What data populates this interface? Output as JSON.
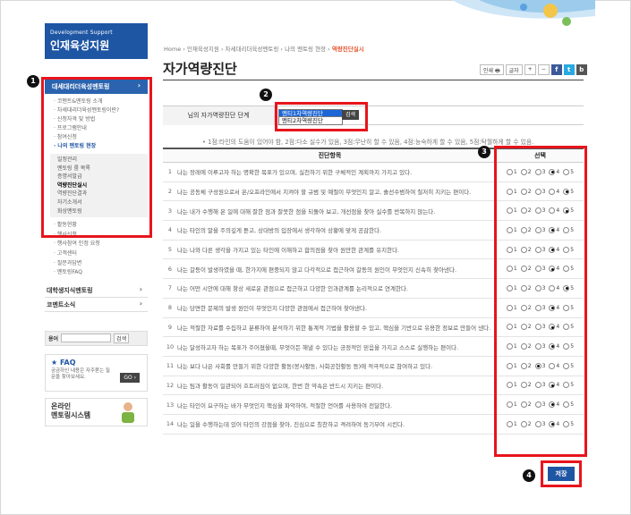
{
  "sidebar": {
    "banner_small": "Development Support",
    "banner_big": "인재육성지원",
    "category": "대세대리더육성멘토링",
    "sub_items_top": [
      "코멘트&멘토링 소개",
      "차세대리더육성멘토링이란?",
      "신청자격 및 방법",
      "프로그램안내",
      "참여신청",
      "나의 멘토링 현장"
    ],
    "active_sub": "나의 멘토링 현장",
    "box_items": [
      "일정관리",
      "멘토링 룸 목록",
      "증명서발급",
      "역량진단실시",
      "역량진단결과",
      "자기소개서",
      "화상멘토링"
    ],
    "active_box": "역량진단실시",
    "sub_items_bottom": [
      "활동현황",
      "행사신청",
      "행사참여 인정 요청",
      "고객센터",
      "질문과답변",
      "멘토링FAQ"
    ],
    "menu": [
      "대학생지식멘토링",
      "코멘트소식"
    ],
    "search_label": "용어",
    "search_button": "검색",
    "faq_title": "FAQ",
    "faq_desc": "궁금하신 내용은 자주묻는 질문을 찾아보세요.",
    "faq_go": "GO",
    "online_line1": "온라인",
    "online_line2": "멘토링시스템"
  },
  "header": {
    "breadcrumb_path": "Home › 인재육성지원 › 차세대리더육성멘토링 › 나의 멘토링 현장 ›",
    "breadcrumb_current": "역량진단실시",
    "title": "자가역량진단",
    "print_label": "인쇄",
    "font_label": "글자",
    "plus": "+",
    "minus": "−",
    "fb": "f",
    "tw": "t",
    "blog": "b"
  },
  "step": {
    "label": "님의 자가역량진단 단계",
    "options": [
      "멘티1차역량진단",
      "멘티2차역량진단"
    ],
    "selected": "멘티1차역량진단",
    "button": "검색"
  },
  "legend": "• 1점:타인의 도움이 있어야 함, 2점:다소 실수가 있음, 3점:무난히 할 수 있음, 4점:능숙하게 할 수 있음, 5점:탁월하게 할 수 있음.",
  "table": {
    "col_item": "진단항목",
    "col_choice": "선택",
    "scale": [
      "1",
      "2",
      "3",
      "4",
      "5"
    ],
    "rows": [
      {
        "num": "1",
        "text": "나는 장래에 이루고자 하는 명확한 목표가 있으며, 실천하기 위한 구체적인 계획까지 가지고 있다.",
        "selected": 4
      },
      {
        "num": "2",
        "text": "나는 공동체 구성원으로서 온/오프라인에서 지켜야 할 규범 및 예절이 무엇인지 알고, 솔선수범하여 철저히 지키는 편이다.",
        "selected": 5
      },
      {
        "num": "3",
        "text": "나는 내가 수행해 온 일에 대해 잘한 점과 잘못한 점을 되돌아 보고, 개선점을 찾아 실수를 반복하지 않는다.",
        "selected": 5
      },
      {
        "num": "4",
        "text": "나는 타인의 말을 주의깊게 듣고, 상대방의 입장에서 생각하여 상황에 맞게 공감한다.",
        "selected": 4
      },
      {
        "num": "5",
        "text": "나는 나와 다른 생각을 가지고 있는 타인에 이해하고 합의점을 찾아 원만한 관계를 유지한다.",
        "selected": 4
      },
      {
        "num": "6",
        "text": "나는 갈등이 발생하였을 때, 한가지에 편중되지 않고 다각적으로 접근하여 갈등의 원인이 무엇인지 신속히 찾아낸다.",
        "selected": 4
      },
      {
        "num": "7",
        "text": "나는 어떤 시안에 대해 항상 새로운 관점으로 접근하고 다양한 인과관계를 논리적으로 연계한다.",
        "selected": 5
      },
      {
        "num": "8",
        "text": "나는 당면한 문제의 발생 원인이 무엇인지 다양한 관점에서 접근하여 찾아낸다.",
        "selected": 4
      },
      {
        "num": "9",
        "text": "나는 적절한 자료를 수집하고 분류하여 분석하기 위한 통계적 기법을 활용할 수 있고, 핵심을 기반으로 유용한 정보로 만들어 낸다.",
        "selected": 4
      },
      {
        "num": "10",
        "text": "나는 달성하고자 하는 목표가 주어졌을때, 무엇이든 해낼 수 있다는 긍정적인 믿음을 가지고 스스로 실행하는 편이다.",
        "selected": 4
      },
      {
        "num": "11",
        "text": "나는 보다 나은 사회를 만들기 위한 다양한 활동(봉사활동, 사회공헌활동 등)에 적극적으로 참여하고 있다.",
        "selected": 3
      },
      {
        "num": "12",
        "text": "나는 팀과 활동이 일관되어 흐트러짐이 없으며, 한번 한 약속은 반드시 지키는 편이다.",
        "selected": 4
      },
      {
        "num": "13",
        "text": "나는 타인이 요구하는 바가 무엇인지 핵심을 파악하여, 적절한 언어를 사용하여 전달한다.",
        "selected": 4
      },
      {
        "num": "14",
        "text": "나는 일을 수행하는데 있어 타인의 강점을 찾아, 진심으로 칭찬하고 격려하여 동기부여 시킨다.",
        "selected": 4
      }
    ]
  },
  "save_button": "저장",
  "badges": [
    "1",
    "2",
    "3",
    "4"
  ],
  "colors": {
    "highlight": "#e8141c",
    "brand": "#1f56a4",
    "selected_option": "#1c66d6"
  }
}
